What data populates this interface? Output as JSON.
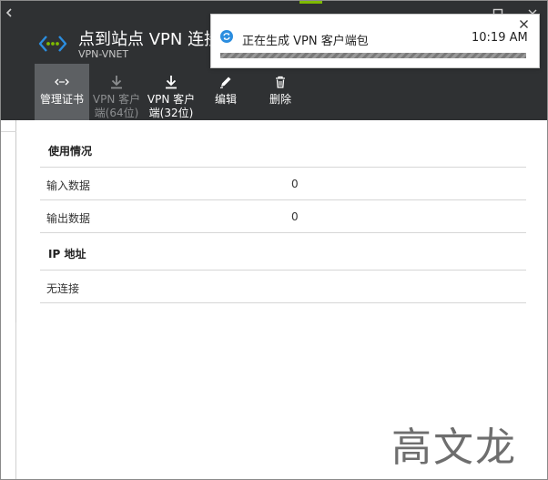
{
  "blade": {
    "title": "点到站点 VPN 连接",
    "subtitle": "VPN-VNET"
  },
  "commands": [
    {
      "label": "管理证书",
      "icon": "certificate-icon",
      "state": "active"
    },
    {
      "label": "VPN 客户端(64位)",
      "icon": "download-icon",
      "state": "disabled"
    },
    {
      "label": "VPN 客户端(32位)",
      "icon": "download-icon",
      "state": "enabled"
    },
    {
      "label": "编辑",
      "icon": "pencil-icon",
      "state": "enabled"
    },
    {
      "label": "删除",
      "icon": "trash-icon",
      "state": "enabled"
    }
  ],
  "usage": {
    "title": "使用情况",
    "rows": [
      {
        "label": "输入数据",
        "value": "0"
      },
      {
        "label": "输出数据",
        "value": "0"
      }
    ]
  },
  "ip": {
    "title": "IP 地址",
    "empty_text": "无连接"
  },
  "notification": {
    "message": "正在生成 VPN 客户端包",
    "time": "10:19 AM",
    "icon": "refresh-icon"
  },
  "watermark": "高文龙",
  "colors": {
    "header_bg": "#2f3133",
    "accent": "#7fba00",
    "icon_blue": "#2b8ddf",
    "active_cmd_bg": "#5d6063"
  }
}
